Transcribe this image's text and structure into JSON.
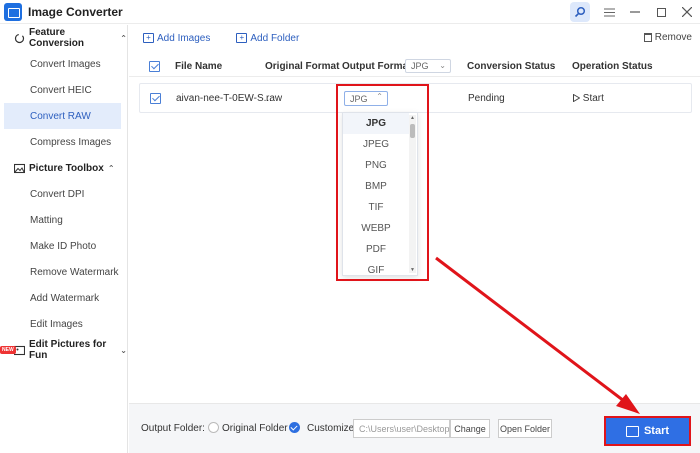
{
  "window": {
    "title": "Image Converter",
    "controls": [
      "search-icon",
      "menu-icon",
      "minimize-icon",
      "maximize-icon",
      "close-icon"
    ]
  },
  "sidebar": {
    "groups": [
      {
        "label": "Feature Conversion",
        "items": [
          "Convert Images",
          "Convert HEIC",
          "Convert RAW",
          "Compress Images"
        ],
        "active": "Convert RAW"
      },
      {
        "label": "Picture Toolbox",
        "items": [
          "Convert DPI",
          "Matting",
          "Make ID Photo",
          "Remove Watermark",
          "Add Watermark",
          "Edit Images"
        ]
      },
      {
        "label": "Edit Pictures for Fun",
        "badge": "NEW"
      }
    ]
  },
  "toolbar": {
    "add_images": "Add Images",
    "add_folder": "Add Folder",
    "remove": "Remove"
  },
  "table": {
    "headers": {
      "file_name": "File Name",
      "original_format": "Original Format",
      "output_format": "Output Format",
      "output_format_value": "JPG",
      "conversion_status": "Conversion Status",
      "operation_status": "Operation Status"
    },
    "rows": [
      {
        "file_name": "aivan-nee-T-0EW-S...",
        "original_format": "raw",
        "output_format": "JPG",
        "conversion_status": "Pending",
        "operation": "Start"
      }
    ]
  },
  "dropdown": {
    "options": [
      "JPG",
      "JPEG",
      "PNG",
      "BMP",
      "TIF",
      "WEBP",
      "PDF",
      "GIF"
    ],
    "selected": "JPG"
  },
  "bottom": {
    "output_folder_label": "Output Folder:",
    "original_folder": "Original Folder",
    "customize": "Customize",
    "path": "C:\\Users\\user\\Desktop",
    "change": "Change",
    "open_folder": "Open Folder",
    "start": "Start"
  },
  "colors": {
    "accent": "#2f6fe4",
    "highlight": "#e0141a",
    "active_bg": "#e3ecfb"
  }
}
